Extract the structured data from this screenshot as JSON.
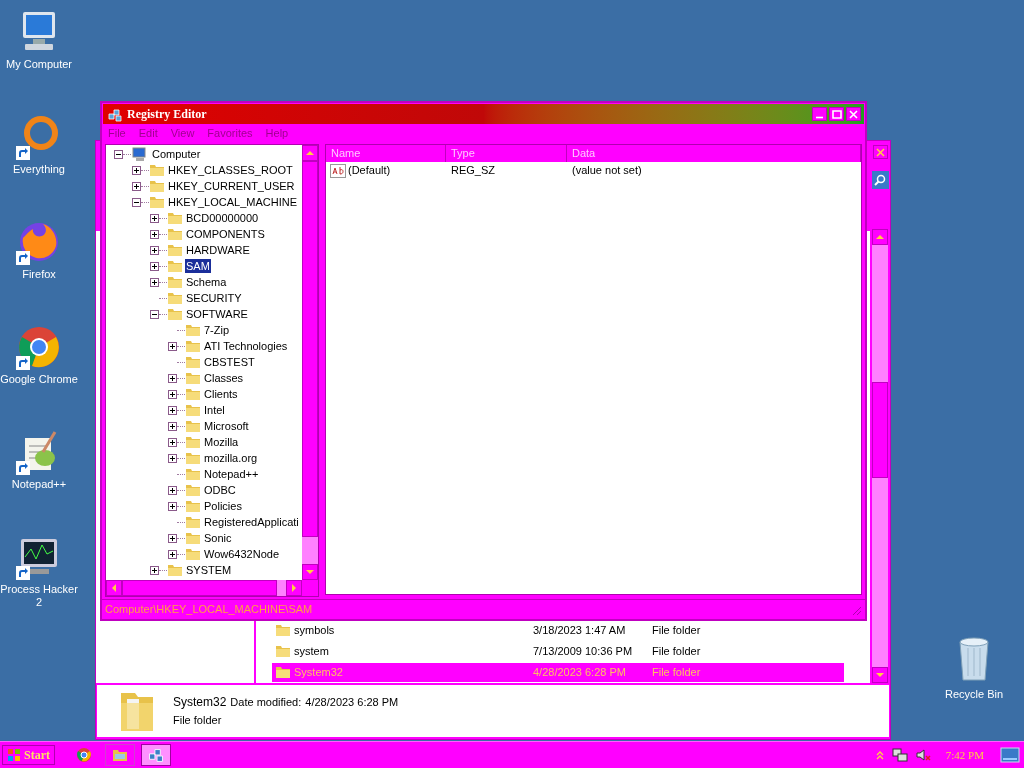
{
  "desktop_icons": [
    {
      "label": "My Computer",
      "kind": "computer",
      "shortcut": false
    },
    {
      "label": "Everything",
      "kind": "ring",
      "shortcut": true
    },
    {
      "label": "Firefox",
      "kind": "firefox",
      "shortcut": true
    },
    {
      "label": "Google Chrome",
      "kind": "chrome",
      "shortcut": true
    },
    {
      "label": "Notepad++",
      "kind": "notepad",
      "shortcut": true
    },
    {
      "label": "Process Hacker 2",
      "kind": "monitor",
      "shortcut": true
    }
  ],
  "recycle_bin": {
    "label": "Recycle Bin"
  },
  "explorer_window": {
    "files": [
      {
        "name": "symbols",
        "date": "3/18/2023 1:47 AM",
        "type": "File folder",
        "selected": false
      },
      {
        "name": "system",
        "date": "7/13/2009 10:36 PM",
        "type": "File folder",
        "selected": false
      },
      {
        "name": "System32",
        "date": "4/28/2023 6:28 PM",
        "type": "File folder",
        "selected": true
      }
    ],
    "details": {
      "name": "System32",
      "date_label": "Date modified:",
      "date": "4/28/2023 6:28 PM",
      "type": "File folder"
    }
  },
  "registry_editor": {
    "title": "Registry Editor",
    "menu": [
      "File",
      "Edit",
      "View",
      "Favorites",
      "Help"
    ],
    "tree": [
      {
        "label": "Computer",
        "kind": "computer",
        "expanded": true,
        "selected": false,
        "children": [
          {
            "label": "HKEY_CLASSES_ROOT",
            "expanded": false,
            "selected": false
          },
          {
            "label": "HKEY_CURRENT_USER",
            "expanded": false,
            "selected": false
          },
          {
            "label": "HKEY_LOCAL_MACHINE",
            "expanded": true,
            "selected": false,
            "children": [
              {
                "label": "BCD00000000",
                "expanded": false,
                "selected": false
              },
              {
                "label": "COMPONENTS",
                "expanded": false,
                "selected": false
              },
              {
                "label": "HARDWARE",
                "expanded": false,
                "selected": false
              },
              {
                "label": "SAM",
                "expanded": false,
                "selected": true
              },
              {
                "label": "Schema",
                "expanded": false,
                "selected": false
              },
              {
                "label": "SECURITY",
                "selected": false
              },
              {
                "label": "SOFTWARE",
                "expanded": true,
                "selected": false,
                "children": [
                  {
                    "label": "7-Zip",
                    "selected": false
                  },
                  {
                    "label": "ATI Technologies",
                    "expanded": false,
                    "selected": false
                  },
                  {
                    "label": "CBSTEST",
                    "selected": false
                  },
                  {
                    "label": "Classes",
                    "expanded": false,
                    "selected": false
                  },
                  {
                    "label": "Clients",
                    "expanded": false,
                    "selected": false
                  },
                  {
                    "label": "Intel",
                    "expanded": false,
                    "selected": false
                  },
                  {
                    "label": "Microsoft",
                    "expanded": false,
                    "selected": false
                  },
                  {
                    "label": "Mozilla",
                    "expanded": false,
                    "selected": false
                  },
                  {
                    "label": "mozilla.org",
                    "expanded": false,
                    "selected": false
                  },
                  {
                    "label": "Notepad++",
                    "selected": false
                  },
                  {
                    "label": "ODBC",
                    "expanded": false,
                    "selected": false
                  },
                  {
                    "label": "Policies",
                    "expanded": false,
                    "selected": false
                  },
                  {
                    "label": "RegisteredApplicati",
                    "selected": false
                  },
                  {
                    "label": "Sonic",
                    "expanded": false,
                    "selected": false
                  },
                  {
                    "label": "Wow6432Node",
                    "expanded": false,
                    "selected": false
                  }
                ]
              },
              {
                "label": "SYSTEM",
                "expanded": false,
                "selected": false
              }
            ]
          }
        ]
      }
    ],
    "columns": [
      "Name",
      "Type",
      "Data"
    ],
    "values": [
      {
        "name": "(Default)",
        "type": "REG_SZ",
        "data": "(value not set)"
      }
    ],
    "status": "Computer\\HKEY_LOCAL_MACHINE\\SAM"
  },
  "taskbar": {
    "start": "Start",
    "buttons": [
      {
        "kind": "chrome",
        "selected": false
      },
      {
        "kind": "explorer",
        "selected": false
      },
      {
        "kind": "regedit",
        "selected": true
      }
    ],
    "clock": "7:42 PM"
  }
}
